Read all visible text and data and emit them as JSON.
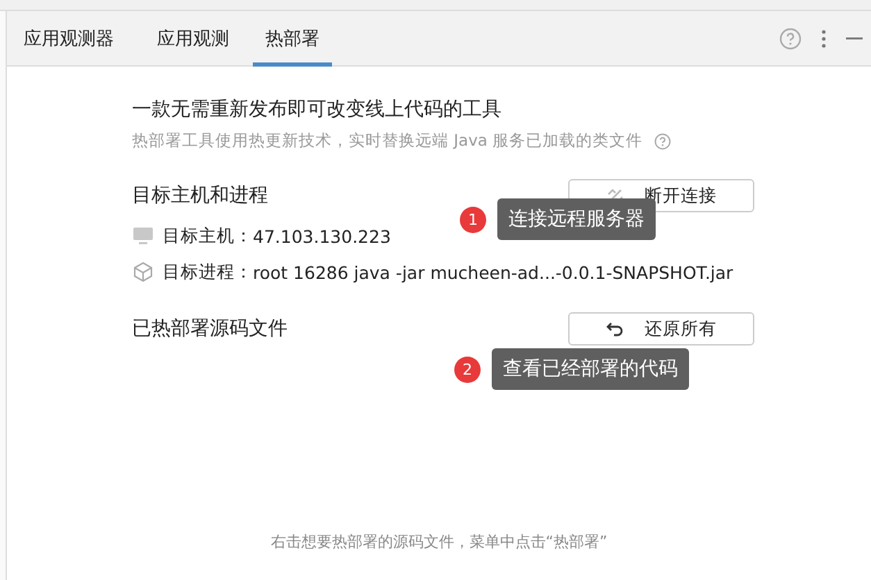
{
  "panel": {
    "title": "应用观测器"
  },
  "tabs": [
    {
      "label": "应用观测",
      "selected": false
    },
    {
      "label": "热部署",
      "selected": true
    }
  ],
  "intro": {
    "heading": "一款无需重新发布即可改变线上代码的工具",
    "description": "热部署工具使用热更新技术，实时替换远端 Java 服务已加载的类文件"
  },
  "target": {
    "heading": "目标主机和进程",
    "button": "断开连接",
    "rows": [
      {
        "kind": "host",
        "label": "目标主机：",
        "value": "47.103.130.223"
      },
      {
        "kind": "process",
        "label": "目标进程：",
        "value": "root 16286 java -jar mucheen-ad...-0.0.1-SNAPSHOT.jar"
      }
    ],
    "callout": {
      "number": "1",
      "text": "连接远程服务器"
    }
  },
  "deployed": {
    "heading": "已热部署源码文件",
    "button": "还原所有",
    "callout": {
      "number": "2",
      "text": "查看已经部署的代码"
    }
  },
  "footer_hint": "右击想要热部署的源码文件，菜单中点击“热部署”"
}
